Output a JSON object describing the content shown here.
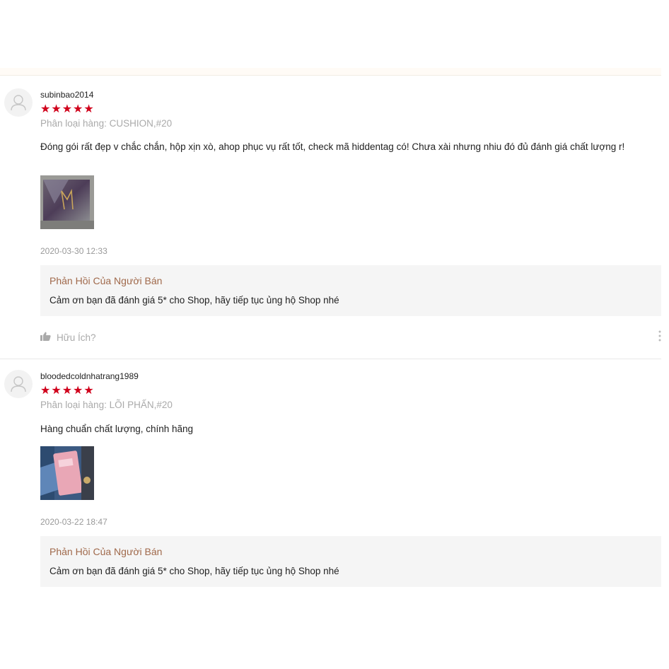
{
  "reviews": [
    {
      "username": "subinbao2014",
      "stars": "★★★★★",
      "variation": "Phân loại hàng: CUSHION,#20",
      "comment": "Đóng gói rất đẹp v chắc chắn, hộp xịn xò, ahop phục vụ rất tốt, check mã hiddentag có! Chưa xài nhưng nhiu đó đủ đánh giá chất lượng r!",
      "time": "2020-03-30 12:33",
      "seller_title": "Phản Hồi Của Người Bán",
      "seller_text": "Cảm ơn bạn đã đánh giá 5* cho Shop, hãy tiếp tục ủng hộ Shop nhé",
      "helpful": "Hữu Ích?"
    },
    {
      "username": "bloodedcoldnhatrang1989",
      "stars": "★★★★★",
      "variation": "Phân loại hàng: LÕI PHẤN,#20",
      "comment": "Hàng chuẩn chất lượng, chính hãng",
      "time": "2020-03-22 18:47",
      "seller_title": "Phản Hồi Của Người Bán",
      "seller_text": "Cảm ơn bạn đã đánh giá 5* cho Shop, hãy tiếp tục ủng hộ Shop nhé"
    }
  ],
  "colors": {
    "star": "#d0011b",
    "seller_title": "#a0694b",
    "muted": "#aaaaaa"
  },
  "icons": [
    "user-avatar-icon",
    "thumbs-up-icon",
    "more-options-icon"
  ]
}
